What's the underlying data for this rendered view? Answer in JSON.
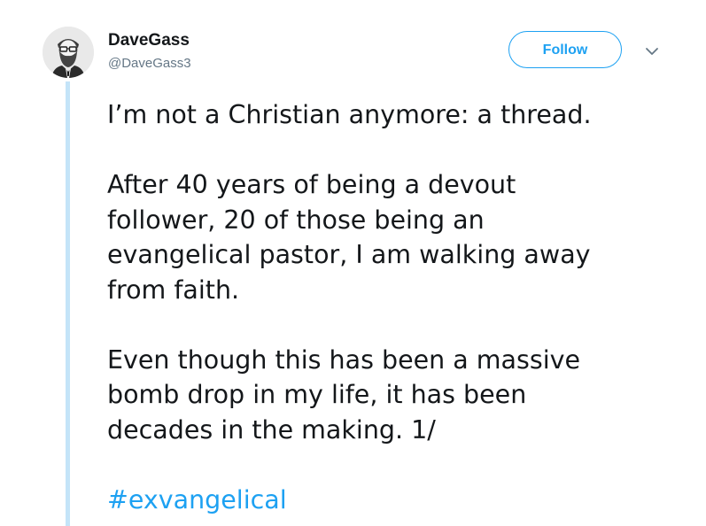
{
  "author": {
    "display_name": "DaveGass",
    "handle": "@DaveGass3",
    "avatar_icon": "bearded-man-avatar-icon"
  },
  "follow_label": "Follow",
  "menu_icon": "chevron-down-icon",
  "tweet": {
    "line1": "I’m not a Christian anymore: a thread.",
    "para2_lines": [
      "After 40 years of being a devout",
      "follower, 20 of those being an",
      "evangelical pastor, I am walking away",
      "from faith."
    ],
    "para3_lines": [
      "Even though this has been a massive",
      "bomb drop in my life, it has been",
      "decades in the making. 1/"
    ],
    "hashtag": "#exvangelical"
  },
  "colors": {
    "accent": "#1da1f2",
    "thread_line": "#c4e4f8",
    "text": "#14171a",
    "secondary_text": "#657786"
  }
}
